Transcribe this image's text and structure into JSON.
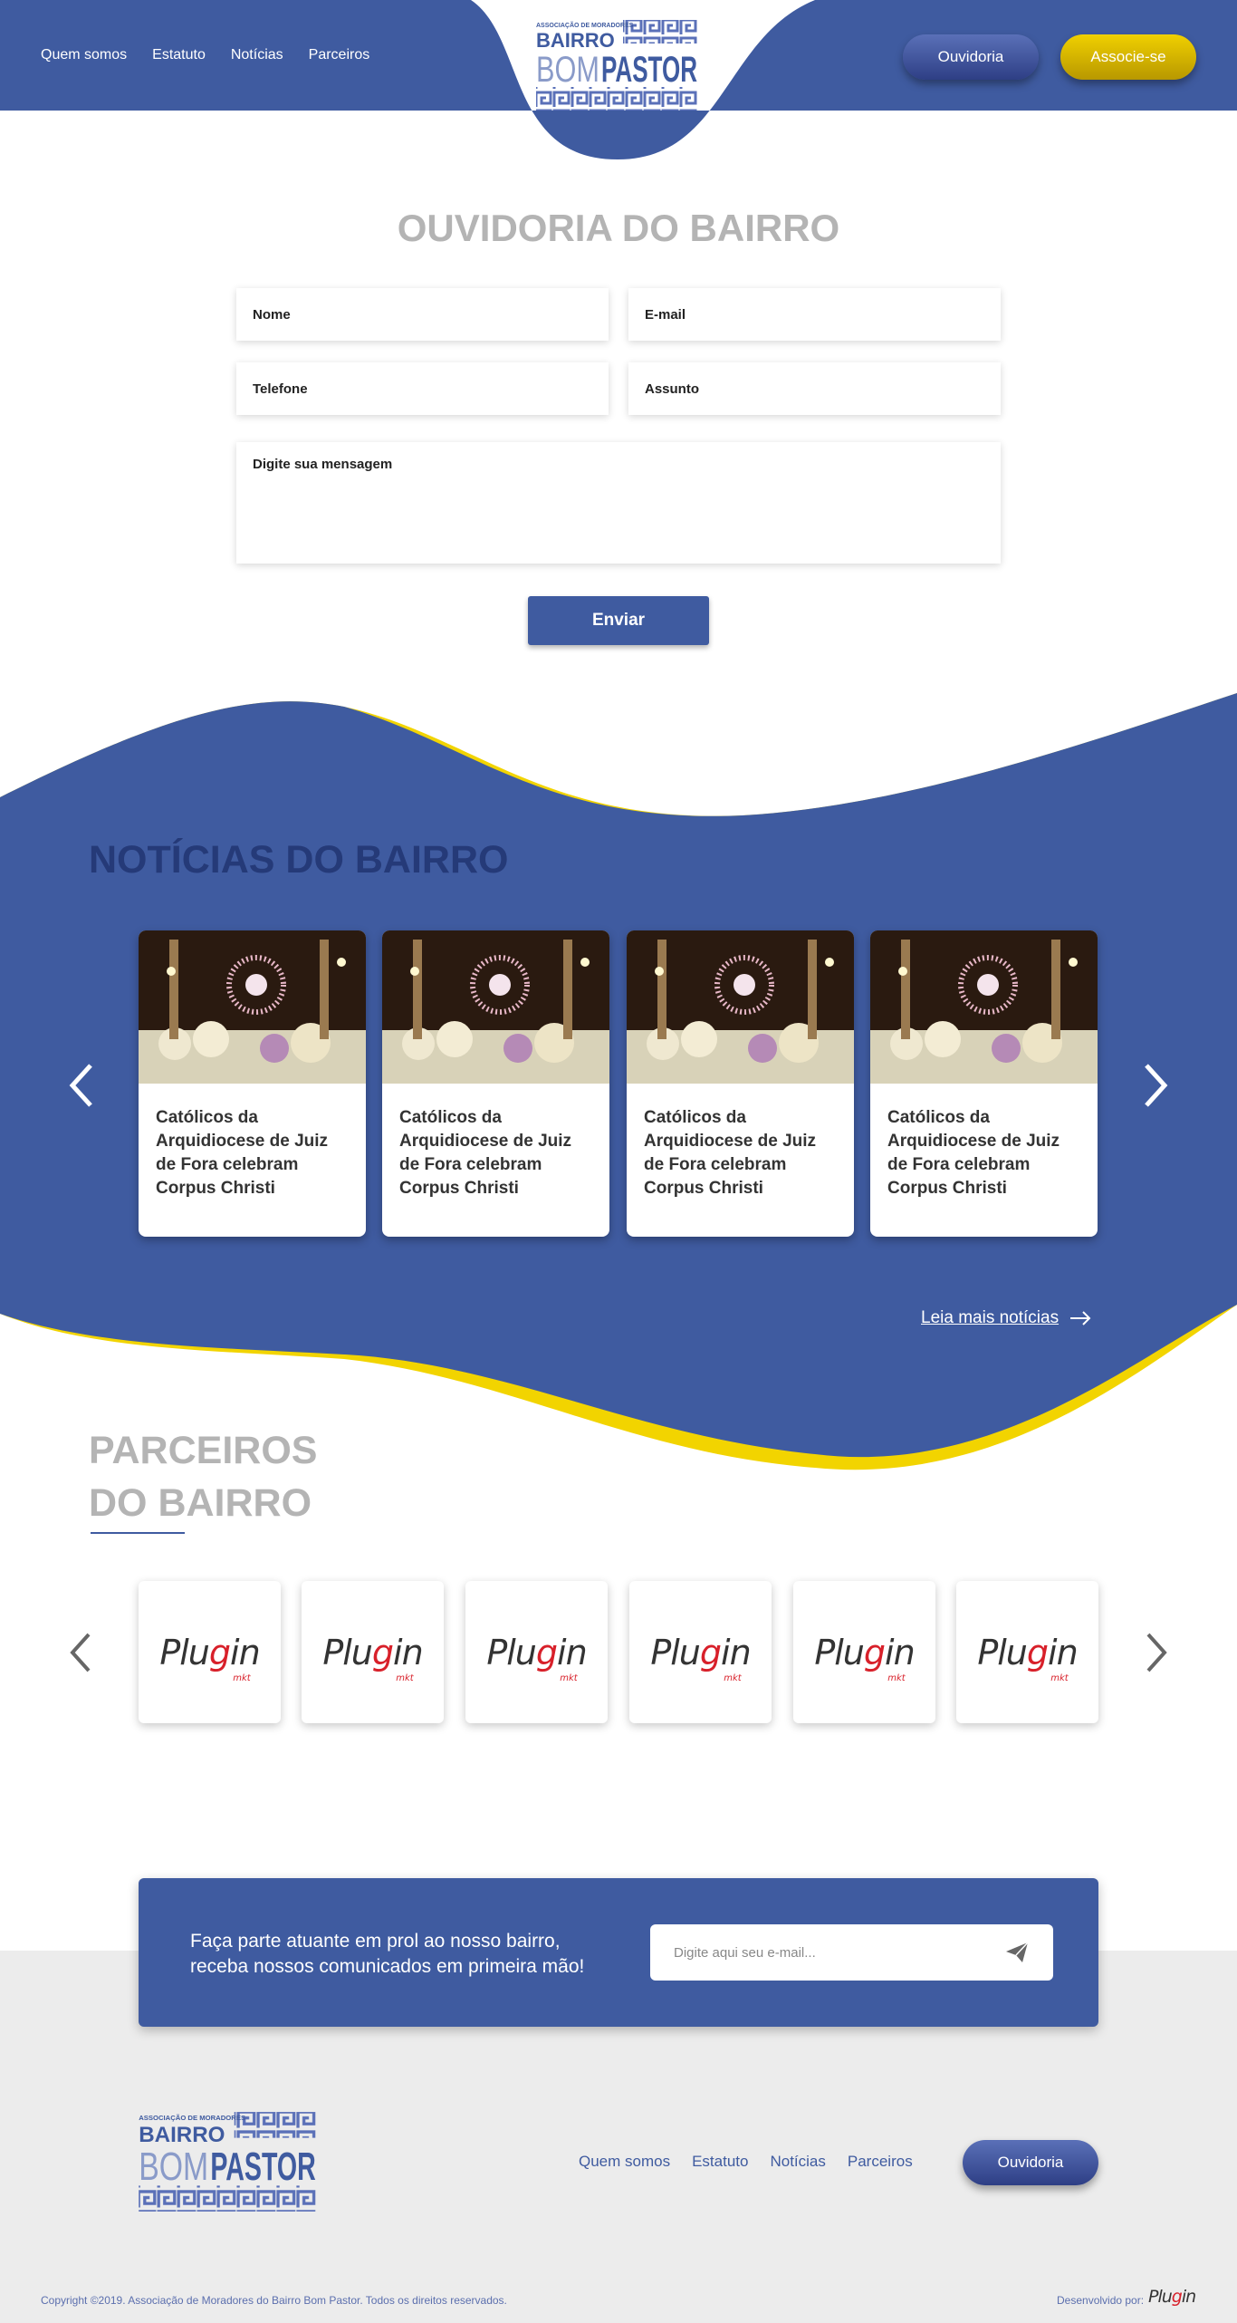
{
  "header": {
    "nav": [
      "Quem somos",
      "Estatuto",
      "Notícias",
      "Parceiros"
    ],
    "logo": {
      "line1": "ASSOCIAÇÃO DE MORADORES",
      "line2": "BAIRRO",
      "line3": "BOM",
      "line4": "PASTOR"
    },
    "ouvidoria_label": "Ouvidoria",
    "associe_label": "Associe-se"
  },
  "ouvidoria": {
    "title": "OUVIDORIA DO BAIRRO",
    "nome": "Nome",
    "email": "E-mail",
    "telefone": "Telefone",
    "assunto": "Assunto",
    "mensagem": "Digite sua mensagem",
    "submit_label": "Enviar"
  },
  "news": {
    "title": "NOTÍCIAS DO BAIRRO",
    "items": [
      {
        "title": "Católicos da Arquidiocese de Juiz de Fora celebram Corpus Christi"
      },
      {
        "title": "Católicos da Arquidiocese de Juiz de Fora celebram Corpus Christi"
      },
      {
        "title": "Católicos da Arquidiocese de Juiz de Fora celebram Corpus Christi"
      },
      {
        "title": "Católicos da Arquidiocese de Juiz de Fora celebram Corpus Christi"
      }
    ],
    "more_label": "Leia mais notícias"
  },
  "partners": {
    "title_line1": "PARCEIROS",
    "title_line2": "DO BAIRRO",
    "logo_text_a": "Plu",
    "logo_text_g": "g",
    "logo_text_b": "in",
    "logo_sub": "mkt"
  },
  "newsletter": {
    "text": "Faça parte atuante em prol ao nosso bairro, receba nossos comunicados em primeira mão!",
    "placeholder": "Digite aqui seu e-mail..."
  },
  "footer": {
    "nav": [
      "Quem somos",
      "Estatuto",
      "Notícias",
      "Parceiros"
    ],
    "ouvidoria_label": "Ouvidoria",
    "copyright": "Copyright ©2019. Associação de Moradores do Bairro Bom Pastor. Todos os direitos reservados.",
    "dev_label": "Desenvolvido por:",
    "dev_logo_a": "Plu",
    "dev_logo_g": "g",
    "dev_logo_b": "in"
  },
  "colors": {
    "primary": "#3f5ba0",
    "dark": "#253a78",
    "yellow": "#f2d400",
    "grey": "#b4b4b4"
  }
}
